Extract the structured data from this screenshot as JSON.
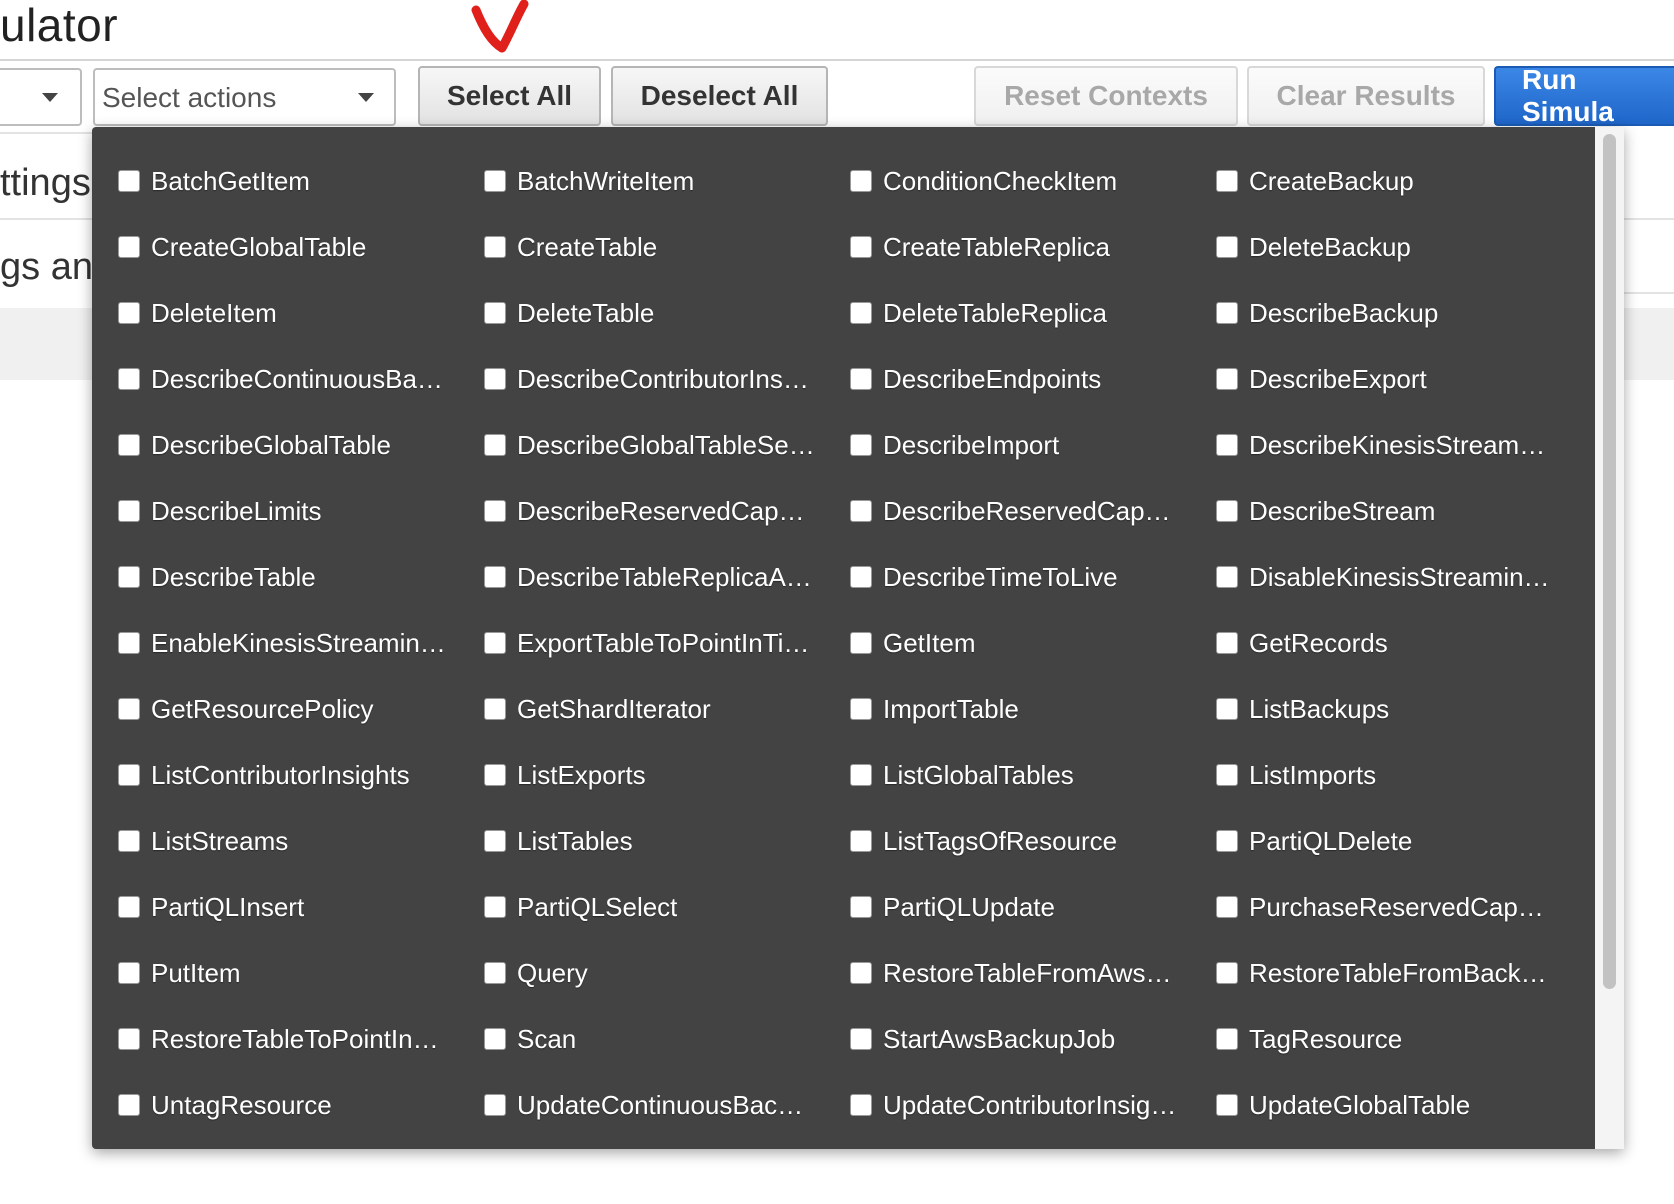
{
  "header": {
    "title": "ulator"
  },
  "toolbar": {
    "service_select_value": "",
    "actions_placeholder": "Select actions",
    "select_all": "Select All",
    "deselect_all": "Deselect All",
    "reset_contexts": "Reset Contexts",
    "clear_results": "Clear Results",
    "run_simulation": "Run Simula"
  },
  "background": {
    "settings_partial": "ttings",
    "settings_and_partial": "gs and"
  },
  "colors": {
    "primary": "#2b7ad6",
    "panel": "#434343",
    "annotation": "#e0201a"
  },
  "actions": [
    "BatchGetItem",
    "BatchWriteItem",
    "ConditionCheckItem",
    "CreateBackup",
    "CreateGlobalTable",
    "CreateTable",
    "CreateTableReplica",
    "DeleteBackup",
    "DeleteItem",
    "DeleteTable",
    "DeleteTableReplica",
    "DescribeBackup",
    "DescribeContinuousBa…",
    "DescribeContributorIns…",
    "DescribeEndpoints",
    "DescribeExport",
    "DescribeGlobalTable",
    "DescribeGlobalTableSe…",
    "DescribeImport",
    "DescribeKinesisStream…",
    "DescribeLimits",
    "DescribeReservedCap…",
    "DescribeReservedCap…",
    "DescribeStream",
    "DescribeTable",
    "DescribeTableReplicaA…",
    "DescribeTimeToLive",
    "DisableKinesisStreamin…",
    "EnableKinesisStreamin…",
    "ExportTableToPointInTi…",
    "GetItem",
    "GetRecords",
    "GetResourcePolicy",
    "GetShardIterator",
    "ImportTable",
    "ListBackups",
    "ListContributorInsights",
    "ListExports",
    "ListGlobalTables",
    "ListImports",
    "ListStreams",
    "ListTables",
    "ListTagsOfResource",
    "PartiQLDelete",
    "PartiQLInsert",
    "PartiQLSelect",
    "PartiQLUpdate",
    "PurchaseReservedCap…",
    "PutItem",
    "Query",
    "RestoreTableFromAws…",
    "RestoreTableFromBack…",
    "RestoreTableToPointIn…",
    "Scan",
    "StartAwsBackupJob",
    "TagResource",
    "UntagResource",
    "UpdateContinuousBac…",
    "UpdateContributorInsig…",
    "UpdateGlobalTable"
  ]
}
